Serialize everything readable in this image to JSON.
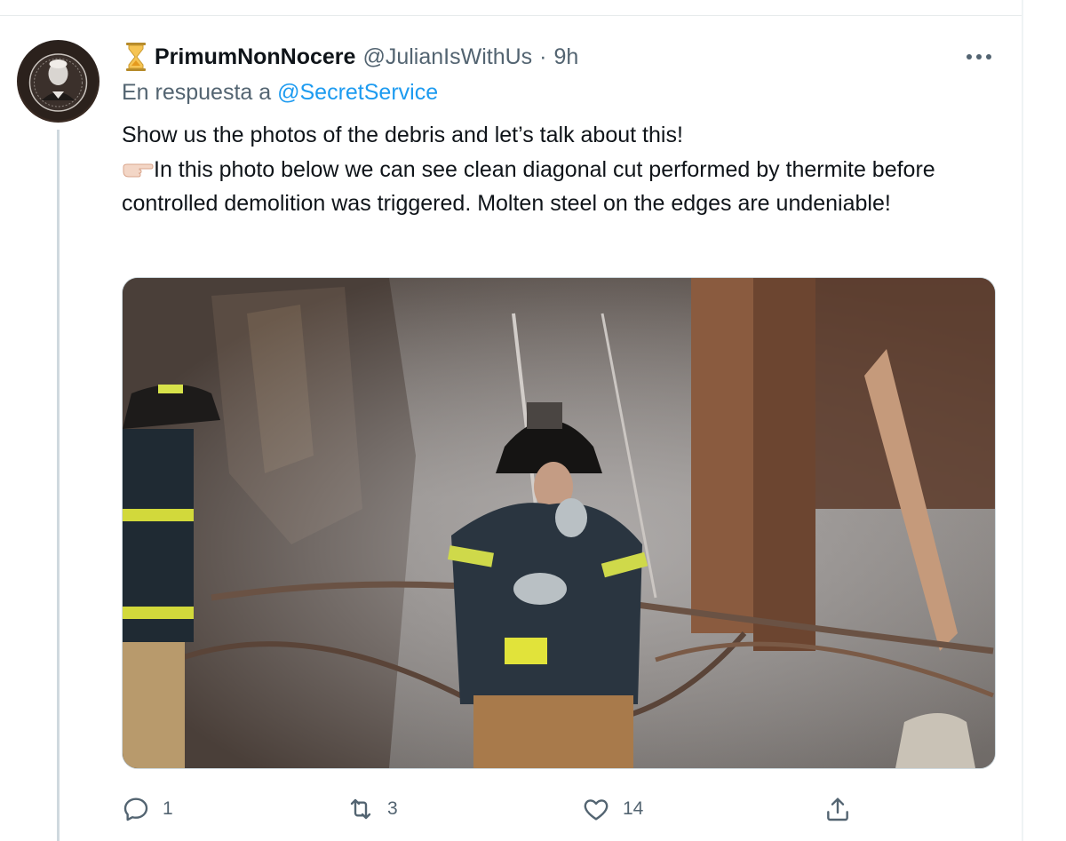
{
  "tweet": {
    "author": {
      "display_name": "PrimumNonNocere",
      "handle": "@JulianIsWithUs",
      "separator": "·",
      "time": "9h",
      "badge_icon": "hourglass-icon"
    },
    "reply_prefix": "En respuesta a",
    "reply_mention": "@SecretService",
    "text_line1": "Show us the photos of the debris and let’s talk about this!",
    "text_line2": "In this photo below we can see clean diagonal cut performed by thermite before controlled demolition was triggered. Molten steel on the edges are undeniable!",
    "inline_icon": "pointing-finger-icon",
    "media_description_icon": "photo",
    "actions": {
      "reply_count": "1",
      "retweet_count": "3",
      "like_count": "14",
      "share_count": ""
    }
  },
  "colors": {
    "text": "#0f1419",
    "secondary": "#536471",
    "link": "#1d9bf0",
    "thread_line": "#cfd9de"
  }
}
